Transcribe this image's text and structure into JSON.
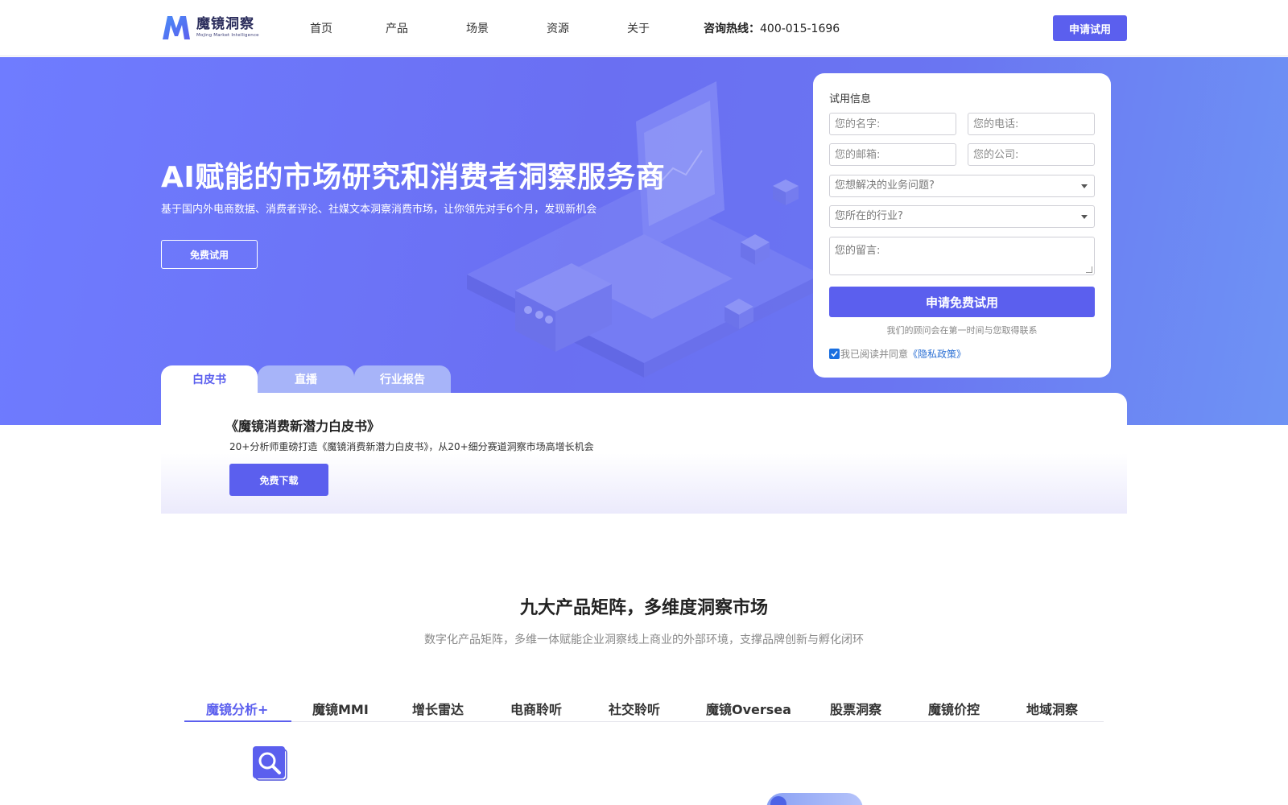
{
  "header": {
    "logo": {
      "name_cn": "魔镜洞察",
      "name_en": "Mojing Market Intelligence",
      "mark_letter": "M"
    },
    "nav": [
      {
        "label": "首页"
      },
      {
        "label": "产品"
      },
      {
        "label": "场景"
      },
      {
        "label": "资源"
      },
      {
        "label": "关于"
      }
    ],
    "hotline_label": "咨询热线：",
    "hotline_number": "400-015-1696",
    "cta_label": "申请试用"
  },
  "hero": {
    "title": "AI赋能的市场研究和消费者洞察服务商",
    "subtitle": "基于国内外电商数据、消费者评论、社媒文本洞察消费市场，让你领先对手6个月，发现新机会",
    "button_label": "免费试用",
    "tabs": [
      {
        "label": "白皮书",
        "active": true
      },
      {
        "label": "直播",
        "active": false
      },
      {
        "label": "行业报告",
        "active": false
      }
    ]
  },
  "form": {
    "title": "试用信息",
    "name_placeholder": "您的名字:",
    "phone_placeholder": "您的电话:",
    "email_placeholder": "您的邮箱:",
    "company_placeholder": "您的公司:",
    "problem_select": "您想解决的业务问题?",
    "industry_select": "您所在的行业?",
    "message_placeholder": "您的留言:",
    "submit_label": "申请免费试用",
    "note": "我们的顾问会在第一时间与您取得联系",
    "agree_text": "我已阅读并同意",
    "policy_link": "《隐私政策》",
    "agree_checked": true
  },
  "whitepaper": {
    "title": "《魔镜消费新潜力白皮书》",
    "description": "20+分析师重磅打造《魔镜消费新潜力白皮书》，从20+细分赛道洞察市场高增长机会",
    "button_label": "免费下载"
  },
  "products": {
    "title": "九大产品矩阵，多维度洞察市场",
    "subtitle": "数字化产品矩阵，多维一体赋能企业洞察线上商业的外部环境，支撑品牌创新与孵化闭环",
    "tabs": [
      {
        "label": "魔镜分析+",
        "active": true
      },
      {
        "label": "魔镜MMI",
        "active": false
      },
      {
        "label": "增长雷达",
        "active": false
      },
      {
        "label": "电商聆听",
        "active": false
      },
      {
        "label": "社交聆听",
        "active": false
      },
      {
        "label": "魔镜Oversea",
        "active": false
      },
      {
        "label": "股票洞察",
        "active": false
      },
      {
        "label": "魔镜价控",
        "active": false
      },
      {
        "label": "地域洞察",
        "active": false
      }
    ],
    "active_icon": "search-icon"
  },
  "colors": {
    "brand": "#5b5fee",
    "hero_gradient_start": "#6f7cff",
    "hero_gradient_end": "#6e93f4",
    "link": "#2a6fd4"
  }
}
